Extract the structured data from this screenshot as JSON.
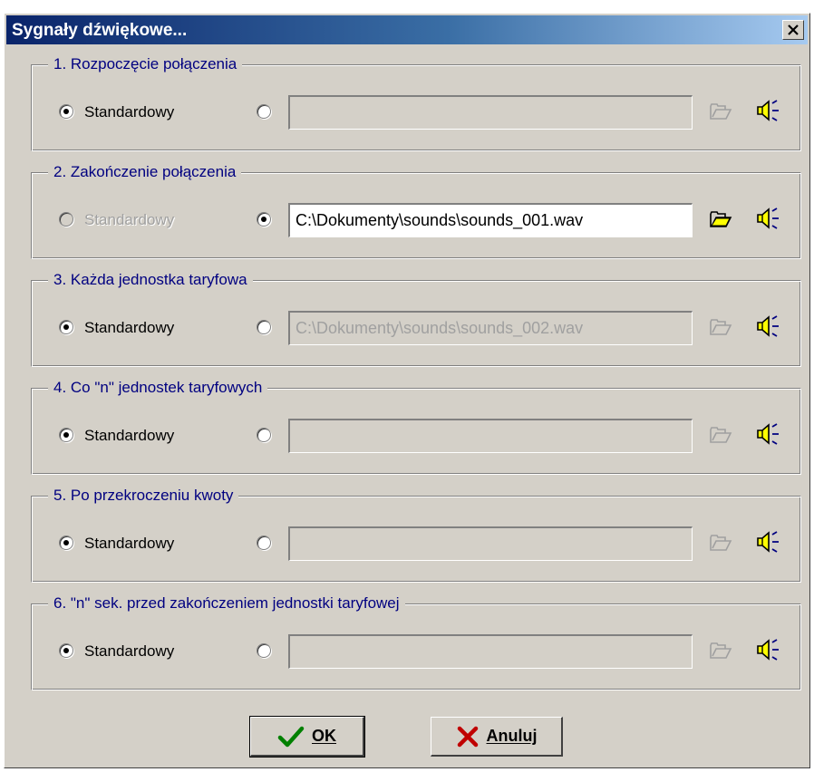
{
  "dialog": {
    "title": "Sygnały dźwiękowe...",
    "close_label": "X"
  },
  "groups": [
    {
      "title": "1. Rozpoczęcie połączenia",
      "standard_label": "Standardowy",
      "selected": "standard",
      "file_path": "",
      "file_enabled": false,
      "standard_enabled": true
    },
    {
      "title": "2. Zakończenie połączenia",
      "standard_label": "Standardowy",
      "selected": "file",
      "file_path": "C:\\Dokumenty\\sounds\\sounds_001.wav",
      "file_enabled": true,
      "standard_enabled": false
    },
    {
      "title": "3. Każda jednostka taryfowa",
      "standard_label": "Standardowy",
      "selected": "standard",
      "file_path": "C:\\Dokumenty\\sounds\\sounds_002.wav",
      "file_enabled": false,
      "standard_enabled": true
    },
    {
      "title": "4. Co \"n\" jednostek taryfowych",
      "standard_label": "Standardowy",
      "selected": "standard",
      "file_path": "",
      "file_enabled": false,
      "standard_enabled": true
    },
    {
      "title": "5. Po przekroczeniu kwoty",
      "standard_label": "Standardowy",
      "selected": "standard",
      "file_path": "",
      "file_enabled": false,
      "standard_enabled": true
    },
    {
      "title": "6. \"n\" sek. przed zakończeniem jednostki taryfowej",
      "standard_label": "Standardowy",
      "selected": "standard",
      "file_path": "",
      "file_enabled": false,
      "standard_enabled": true
    }
  ],
  "buttons": {
    "ok_label": "OK",
    "cancel_label": "Anuluj"
  },
  "colors": {
    "title_gradient_start": "#0a246a",
    "title_gradient_end": "#a6caf0",
    "group_title": "#000080",
    "face": "#d4d0c8",
    "speaker_yellow": "#ffff00",
    "folder_yellow": "#ffff00",
    "ok_check": "#008000",
    "cancel_x": "#c00000"
  },
  "icons": {
    "folder": "folder-open-icon",
    "speaker": "speaker-icon",
    "ok": "checkmark-icon",
    "cancel": "x-icon"
  }
}
